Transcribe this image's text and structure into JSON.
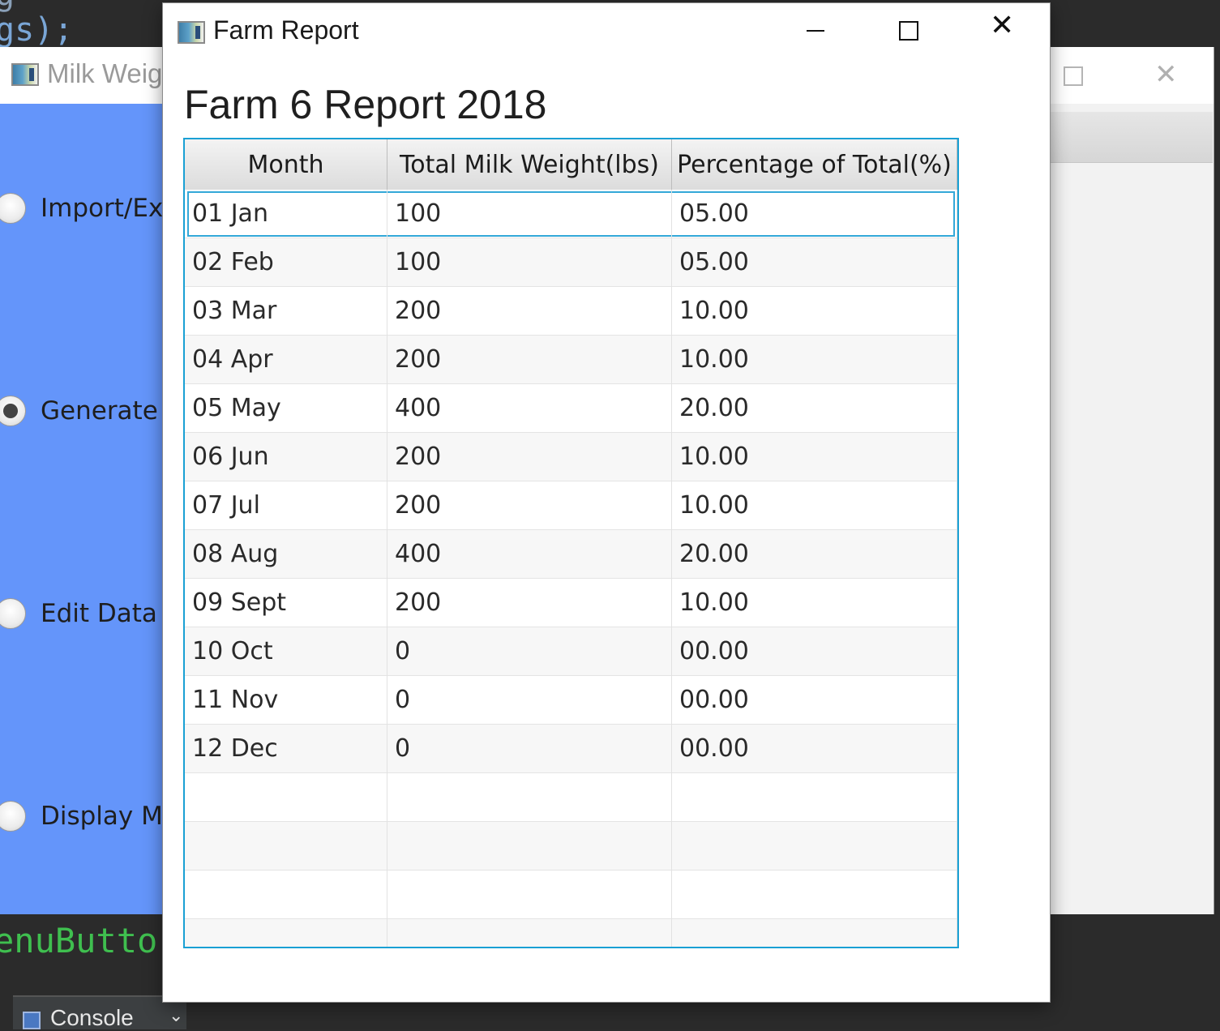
{
  "background": {
    "ide": {
      "code_top_line": "gs);",
      "code_bottom_line": "enuButto",
      "console_tab_label": "Console",
      "console_tab_chevron": "⌄"
    },
    "milk_window": {
      "title": "Milk Weig",
      "options": [
        {
          "label": "Import/Exp",
          "selected": false
        },
        {
          "label": "Generate R",
          "selected": true
        },
        {
          "label": "Edit Data",
          "selected": false
        },
        {
          "label": "Display Ma",
          "selected": false
        }
      ],
      "left_panel_color": "#6495fa"
    }
  },
  "report_window": {
    "title": "Farm Report",
    "heading": "Farm 6 Report 2018",
    "controls": {
      "minimize": "minimize",
      "maximize": "maximize",
      "close": "close"
    },
    "table": {
      "columns": [
        "Month",
        "Total Milk Weight(lbs)",
        "Percentage of Total(%)"
      ],
      "rows": [
        [
          "01 Jan",
          "100",
          "05.00"
        ],
        [
          "02 Feb",
          "100",
          "05.00"
        ],
        [
          "03 Mar",
          "200",
          "10.00"
        ],
        [
          "04 Apr",
          "200",
          "10.00"
        ],
        [
          "05 May",
          "400",
          "20.00"
        ],
        [
          "06 Jun",
          "200",
          "10.00"
        ],
        [
          "07 Jul",
          "200",
          "10.00"
        ],
        [
          "08 Aug",
          "400",
          "20.00"
        ],
        [
          "09 Sept",
          "200",
          "10.00"
        ],
        [
          "10 Oct",
          "0",
          "00.00"
        ],
        [
          "11 Nov",
          "0",
          "00.00"
        ],
        [
          "12 Dec",
          "0",
          "00.00"
        ]
      ],
      "empty_rows": 4,
      "focused_row": 0,
      "border_color": "#1aa0d4"
    }
  }
}
